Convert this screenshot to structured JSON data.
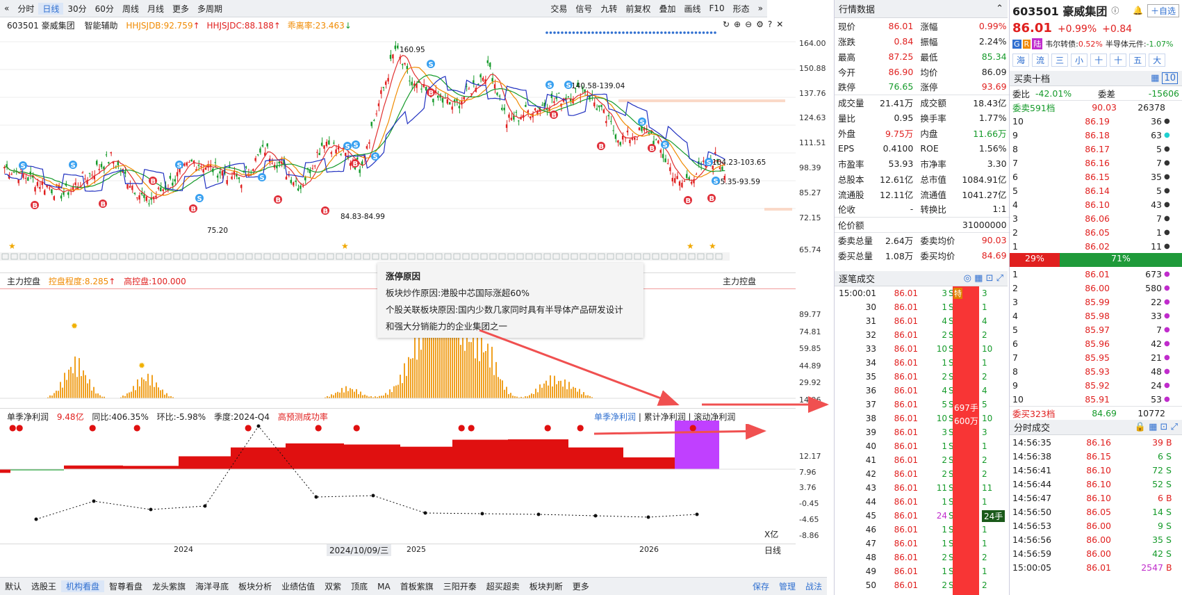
{
  "toolbar": {
    "periods": [
      "分时",
      "日线",
      "30分",
      "60分",
      "周线",
      "月线",
      "更多",
      "多周期"
    ],
    "right": [
      "交易",
      "信号",
      "九转",
      "前复权",
      "叠加",
      "画线",
      "F10",
      "形态"
    ]
  },
  "stock": {
    "code": "603501",
    "name": "豪威集团",
    "assist": "智能辅助",
    "ind1": "HHJSJDB:92.759",
    "ind2": "HHJSJDC:88.188",
    "ind3": "乖离率:23.463"
  },
  "chart": {
    "y_ticks": [
      "164.00",
      "150.88",
      "137.76",
      "124.63",
      "111.51",
      "98.39",
      "85.27",
      "72.15",
      "65.74"
    ],
    "labels": [
      "160.95",
      "140.58-139.04",
      "104.23-103.65",
      "84.83-84.99",
      "75.20",
      "95.35-93.59"
    ]
  },
  "sub1": {
    "title": "主力控盘",
    "level": "控盘程度:8.285",
    "high": "高控盘:100.000",
    "right_title": "主力控盘",
    "ticks": [
      "89.77",
      "74.81",
      "59.85",
      "44.89",
      "29.92",
      "14.96"
    ]
  },
  "sub2": {
    "title": "单季净利润",
    "value": "9.48亿",
    "yoy": "同比:406.35%",
    "qoq": "环比:-5.98%",
    "season": "季度:2024-Q4",
    "hint": "高预测成功率",
    "tabs": [
      "单季净利润",
      "累计净利润",
      "滚动净利润"
    ],
    "ticks": [
      "12.17",
      "7.96",
      "3.76",
      "-0.45",
      "-4.65",
      "-8.86"
    ],
    "unit": "X亿"
  },
  "xaxis": {
    "labels": [
      "2024",
      "2024/10/09/三",
      "2025",
      "2026"
    ]
  },
  "bottom": {
    "items": [
      "默认",
      "选股王",
      "机构看盘",
      "智尊看盘",
      "龙头紫旗",
      "海洋寻底",
      "板块分析",
      "业绩估值",
      "双紫",
      "顶底",
      "MA",
      "首板紫旗",
      "三阳开泰",
      "超买超卖",
      "板块判断",
      "更多"
    ],
    "right": [
      "日线",
      "保存",
      "管理",
      "战法"
    ]
  },
  "tooltip": {
    "title": "涨停原因",
    "line1": "板块炒作原因:港股中芯国际涨超60%",
    "line2": "个股关联板块原因:国内少数几家同时具有半导体产品研发设计",
    "line3": "和强大分销能力的企业集团之一"
  },
  "quote": {
    "title": "行情数据",
    "rows": [
      [
        "现价",
        "86.01",
        "涨幅",
        "0.99%"
      ],
      [
        "涨跌",
        "0.84",
        "振幅",
        "2.24%"
      ],
      [
        "最高",
        "87.25",
        "最低",
        "85.34"
      ],
      [
        "今开",
        "86.90",
        "均价",
        "86.09"
      ],
      [
        "跌停",
        "76.65",
        "涨停",
        "93.69"
      ],
      [
        "成交量",
        "21.41万",
        "成交额",
        "18.43亿"
      ],
      [
        "量比",
        "0.95",
        "换手率",
        "1.77%"
      ],
      [
        "外盘",
        "9.75万",
        "内盘",
        "11.66万"
      ],
      [
        "EPS",
        "0.4100",
        "ROE",
        "1.56%"
      ],
      [
        "市盈率",
        "53.93",
        "市净率",
        "3.30"
      ],
      [
        "总股本",
        "12.61亿",
        "总市值",
        "1084.91亿"
      ],
      [
        "流通股",
        "12.11亿",
        "流通值",
        "1041.27亿"
      ],
      [
        "伦收",
        "-",
        "转换比",
        "1:1"
      ],
      [
        "伦价额",
        "",
        "",
        "31000000"
      ],
      [
        "委卖总量",
        "2.64万",
        "委卖均价",
        "90.03"
      ],
      [
        "委买总量",
        "1.08万",
        "委买均价",
        "84.69"
      ]
    ]
  },
  "ticks": {
    "title": "逐笔成交",
    "rows": [
      [
        "15:00:01",
        "86.01",
        "3",
        "3"
      ],
      [
        "30",
        "86.01",
        "1",
        "1"
      ],
      [
        "31",
        "86.01",
        "4",
        "4"
      ],
      [
        "32",
        "86.01",
        "2",
        "2"
      ],
      [
        "33",
        "86.01",
        "10",
        "10"
      ],
      [
        "34",
        "86.01",
        "1",
        "1"
      ],
      [
        "35",
        "86.01",
        "2",
        "2"
      ],
      [
        "36",
        "86.01",
        "4",
        "4"
      ],
      [
        "37",
        "86.01",
        "5",
        "5"
      ],
      [
        "38",
        "86.01",
        "10",
        "10"
      ],
      [
        "39",
        "86.01",
        "3",
        "3"
      ],
      [
        "40",
        "86.01",
        "1",
        "1"
      ],
      [
        "41",
        "86.01",
        "2",
        "2"
      ],
      [
        "42",
        "86.01",
        "2",
        "2"
      ],
      [
        "43",
        "86.01",
        "11",
        "11"
      ],
      [
        "44",
        "86.01",
        "1",
        "1"
      ],
      [
        "45",
        "86.01",
        "24",
        "24手"
      ],
      [
        "46",
        "86.01",
        "1",
        "1"
      ],
      [
        "47",
        "86.01",
        "1",
        "1"
      ],
      [
        "48",
        "86.01",
        "2",
        "2"
      ],
      [
        "49",
        "86.01",
        "1",
        "1"
      ],
      [
        "50",
        "86.01",
        "2",
        "2"
      ]
    ],
    "big_label1": "697手",
    "big_label2": "600万",
    "special": "特"
  },
  "orderbook": {
    "title_name": "603501 豪威集团",
    "price": "86.01",
    "pct": "+0.99%",
    "chg": "+0.84",
    "add": "自选",
    "bond": "韦尔转债:",
    "bond_pct": "0.52%",
    "sector": "半导体元件:",
    "sector_pct": "-1.07%",
    "tags": [
      "G",
      "R",
      "陆"
    ],
    "btns": [
      "海",
      "流",
      "三",
      "小",
      "十",
      "十",
      "五",
      "大"
    ],
    "book_title": "买卖十档",
    "weibi": "委比",
    "weibi_val": "-42.01%",
    "weicha": "委差",
    "weicha_val": "-15606",
    "sell_total": "委卖591档",
    "sell_total_p": "90.03",
    "sell_total_v": "26378",
    "sells": [
      [
        "10",
        "86.19",
        "36"
      ],
      [
        "9",
        "86.18",
        "63"
      ],
      [
        "8",
        "86.17",
        "5"
      ],
      [
        "7",
        "86.16",
        "7"
      ],
      [
        "6",
        "86.15",
        "35"
      ],
      [
        "5",
        "86.14",
        "5"
      ],
      [
        "4",
        "86.10",
        "43"
      ],
      [
        "3",
        "86.06",
        "7"
      ],
      [
        "2",
        "86.05",
        "1"
      ],
      [
        "1",
        "86.02",
        "11"
      ]
    ],
    "ratio_sell": "29%",
    "ratio_buy": "71%",
    "buys": [
      [
        "1",
        "86.01",
        "673"
      ],
      [
        "2",
        "86.00",
        "580"
      ],
      [
        "3",
        "85.99",
        "22"
      ],
      [
        "4",
        "85.98",
        "33"
      ],
      [
        "5",
        "85.97",
        "7"
      ],
      [
        "6",
        "85.96",
        "42"
      ],
      [
        "7",
        "85.95",
        "21"
      ],
      [
        "8",
        "85.93",
        "48"
      ],
      [
        "9",
        "85.92",
        "24"
      ],
      [
        "10",
        "85.91",
        "53"
      ]
    ],
    "buy_total": "委买323档",
    "buy_total_p": "84.69",
    "buy_total_v": "10772",
    "trades_title": "分时成交",
    "trades": [
      [
        "14:56:35",
        "86.16",
        "39",
        "B"
      ],
      [
        "14:56:38",
        "86.15",
        "6",
        "S"
      ],
      [
        "14:56:41",
        "86.10",
        "72",
        "S"
      ],
      [
        "14:56:44",
        "86.10",
        "52",
        "S"
      ],
      [
        "14:56:47",
        "86.10",
        "6",
        "B"
      ],
      [
        "14:56:50",
        "86.05",
        "14",
        "S"
      ],
      [
        "14:56:53",
        "86.00",
        "9",
        "S"
      ],
      [
        "14:56:56",
        "86.00",
        "35",
        "S"
      ],
      [
        "14:56:59",
        "86.00",
        "42",
        "S"
      ],
      [
        "15:00:05",
        "86.01",
        "2547",
        "B"
      ]
    ]
  },
  "colors": {
    "up": "#e0201f",
    "down": "#159a2a",
    "accent": "#2f6fd0",
    "orange": "#f08a00",
    "purple": "#c040ff"
  }
}
